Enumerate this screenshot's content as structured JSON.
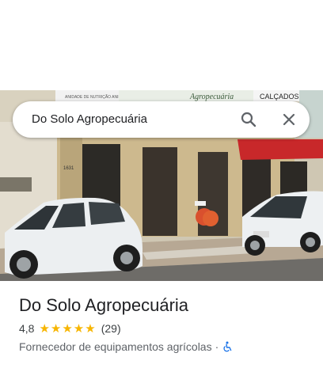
{
  "search": {
    "query": "Do Solo Agropecuária",
    "search_icon": "search-icon",
    "close_icon": "close-icon"
  },
  "photo": {
    "alt": "storefront-photo",
    "sign_texts": [
      "ANIDADE DE NUTRIÇÃO ANIMAL",
      "Agropecuária",
      "CALÇADOS",
      "1631"
    ]
  },
  "place": {
    "name": "Do Solo Agropecuária",
    "rating": "4,8",
    "stars": "★★★★★",
    "review_count": "(29)",
    "category": "Fornecedor de equipamentos agrícolas",
    "separator": "·",
    "accessibility_icon": "wheelchair-icon"
  },
  "colors": {
    "star": "#f7b500",
    "accessibility": "#1a73e8",
    "awning": "#c8282a"
  }
}
